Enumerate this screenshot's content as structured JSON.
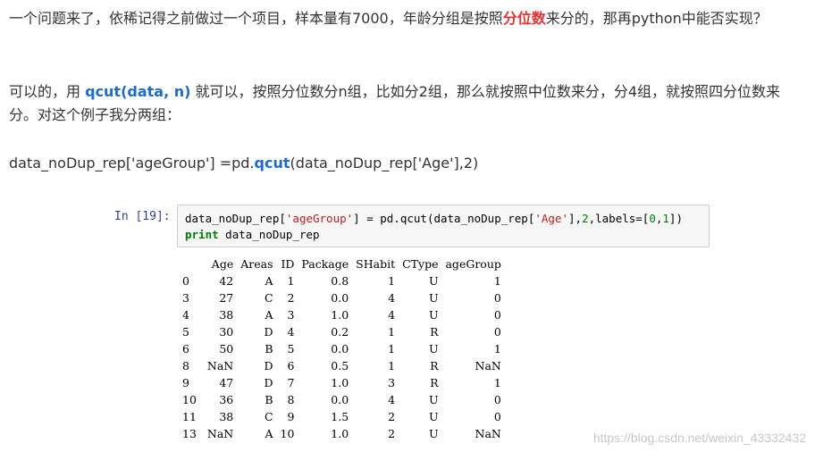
{
  "article": {
    "p1_part1": "一个问题来了，依稀记得之前做过一个项目，样本量有7000，年龄分组是按照",
    "p1_highlight": "分位数",
    "p1_part2": "来分的，那再python中能否实现？",
    "p2_part1": "可以的，用 ",
    "p2_highlight": "qcut(data, n)",
    "p2_part2": " 就可以，按照分位数分n组，比如分2组，那么就按照中位数来分，分4组，就按照四分位数来分。对这个例子我分两组：",
    "p3_part1": "data_noDup_rep['ageGroup'] =pd.",
    "p3_highlight": "qcut",
    "p3_part2": "(data_noDup_rep['Age'],2)"
  },
  "notebook": {
    "prompt": "In [19]:",
    "code_line1_a": "data_noDup_rep[",
    "code_line1_str1": "'ageGroup'",
    "code_line1_b": "] = pd.qcut(data_noDup_rep[",
    "code_line1_str2": "'Age'",
    "code_line1_c": "],",
    "code_line1_num1": "2",
    "code_line1_d": ",labels=[",
    "code_line1_num2": "0",
    "code_line1_e": ",",
    "code_line1_num3": "1",
    "code_line1_f": "])",
    "code_line2_kw": "print",
    "code_line2_rest": " data_noDup_rep"
  },
  "table": {
    "columns": [
      "Age",
      "Areas",
      "ID",
      "Package",
      "SHabit",
      "CType",
      "ageGroup"
    ],
    "rows": [
      [
        "0",
        "42",
        "A",
        "1",
        "0.8",
        "1",
        "U",
        "1"
      ],
      [
        "3",
        "27",
        "C",
        "2",
        "0.0",
        "4",
        "U",
        "0"
      ],
      [
        "4",
        "38",
        "A",
        "3",
        "1.0",
        "4",
        "U",
        "0"
      ],
      [
        "5",
        "30",
        "D",
        "4",
        "0.2",
        "1",
        "R",
        "0"
      ],
      [
        "6",
        "50",
        "B",
        "5",
        "0.0",
        "1",
        "U",
        "1"
      ],
      [
        "8",
        "NaN",
        "D",
        "6",
        "0.5",
        "1",
        "R",
        "NaN"
      ],
      [
        "9",
        "47",
        "D",
        "7",
        "1.0",
        "3",
        "R",
        "1"
      ],
      [
        "10",
        "36",
        "B",
        "8",
        "0.0",
        "4",
        "U",
        "0"
      ],
      [
        "11",
        "38",
        "C",
        "9",
        "1.5",
        "2",
        "U",
        "0"
      ],
      [
        "13",
        "NaN",
        "A",
        "10",
        "1.0",
        "2",
        "U",
        "NaN"
      ]
    ]
  },
  "watermark": "https://blog.csdn.net/weixin_43332432"
}
